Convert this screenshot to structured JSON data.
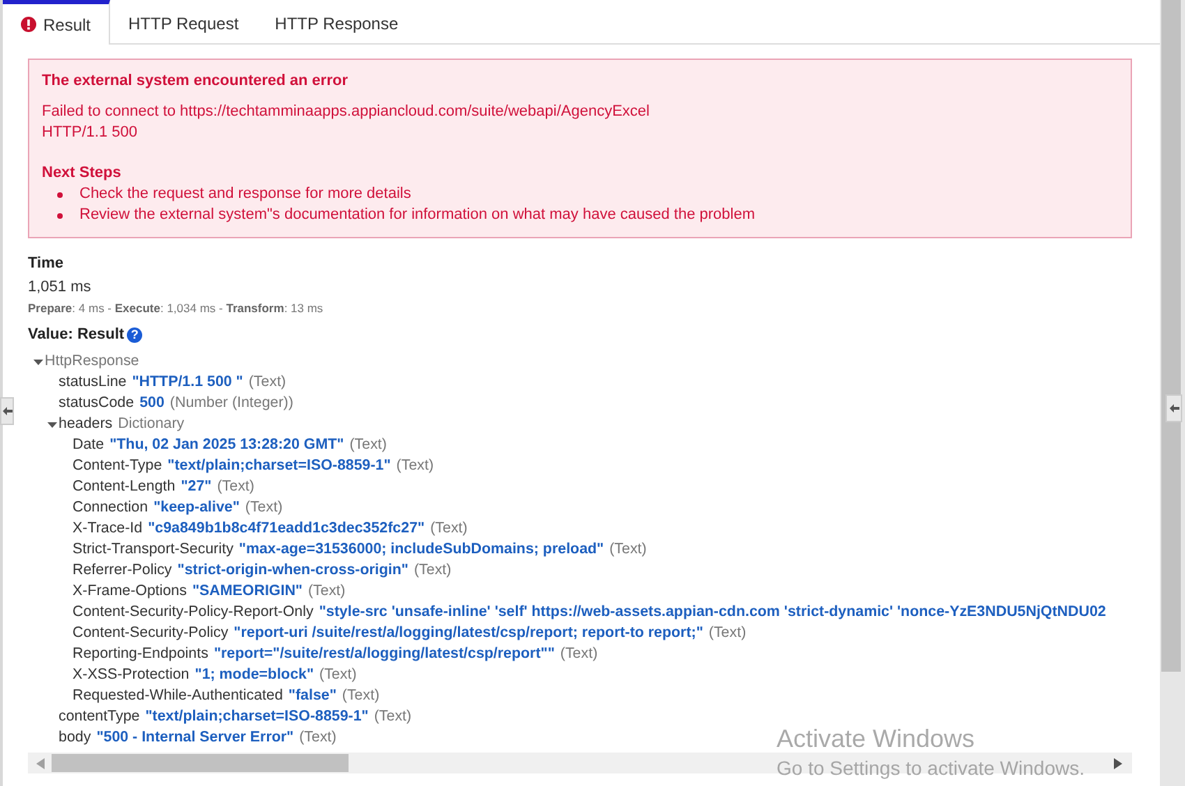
{
  "tabs": [
    {
      "label": "Result",
      "selected": true,
      "error": true
    },
    {
      "label": "HTTP Request",
      "selected": false,
      "error": false
    },
    {
      "label": "HTTP Response",
      "selected": false,
      "error": false
    }
  ],
  "error_box": {
    "title": "The external system encountered an error",
    "message_lines": [
      "Failed to connect to https://techtamminaapps.appiancloud.com/suite/webapi/AgencyExcel",
      "HTTP/1.1 500"
    ],
    "next_steps_title": "Next Steps",
    "next_steps": [
      "Check the request and response for more details",
      "Review the external system\"s documentation for information on what may have caused the problem"
    ]
  },
  "time": {
    "label": "Time",
    "total": "1,051 ms",
    "breakdown": "**Prepare**: 4 ms - **Execute**: 1,034 ms - **Transform**: 13 ms"
  },
  "value": {
    "label": "Value: Result",
    "help_glyph": "?"
  },
  "tree": [
    {
      "type": "HttpResponse",
      "expanded": true,
      "children": [
        {
          "key": "statusLine",
          "value": "\"HTTP/1.1 500 \"",
          "type": "(Text)"
        },
        {
          "key": "statusCode",
          "value": "500",
          "type": "(Number (Integer))"
        },
        {
          "key": "headers",
          "type": "Dictionary",
          "expanded": true,
          "children": [
            {
              "key": "Date",
              "value": "\"Thu, 02 Jan 2025 13:28:20 GMT\"",
              "type": "(Text)"
            },
            {
              "key": "Content-Type",
              "value": "\"text/plain;charset=ISO-8859-1\"",
              "type": "(Text)"
            },
            {
              "key": "Content-Length",
              "value": "\"27\"",
              "type": "(Text)"
            },
            {
              "key": "Connection",
              "value": "\"keep-alive\"",
              "type": "(Text)"
            },
            {
              "key": "X-Trace-Id",
              "value": "\"c9a849b1b8c4f71eadd1c3dec352fc27\"",
              "type": "(Text)"
            },
            {
              "key": "Strict-Transport-Security",
              "value": "\"max-age=31536000; includeSubDomains; preload\"",
              "type": "(Text)"
            },
            {
              "key": "Referrer-Policy",
              "value": "\"strict-origin-when-cross-origin\"",
              "type": "(Text)"
            },
            {
              "key": "X-Frame-Options",
              "value": "\"SAMEORIGIN\"",
              "type": "(Text)"
            },
            {
              "key": "Content-Security-Policy-Report-Only",
              "value": "\"style-src 'unsafe-inline' 'self' https://web-assets.appian-cdn.com 'strict-dynamic' 'nonce-YzE3NDU5NjQtNDU02"
            },
            {
              "key": "Content-Security-Policy",
              "value": "\"report-uri /suite/rest/a/logging/latest/csp/report; report-to report;\"",
              "type": "(Text)"
            },
            {
              "key": "Reporting-Endpoints",
              "value": "\"report=\"/suite/rest/a/logging/latest/csp/report\"\"",
              "type": "(Text)"
            },
            {
              "key": "X-XSS-Protection",
              "value": "\"1; mode=block\"",
              "type": "(Text)"
            },
            {
              "key": "Requested-While-Authenticated",
              "value": "\"false\"",
              "type": "(Text)"
            }
          ]
        },
        {
          "key": "contentType",
          "value": "\"text/plain;charset=ISO-8859-1\"",
          "type": "(Text)"
        },
        {
          "key": "body",
          "value": "\"500 - Internal Server Error\"",
          "type": "(Text)"
        }
      ]
    }
  ],
  "os_overlay": {
    "title": "Activate Windows",
    "subtitle": "Go to Settings to activate Windows."
  }
}
